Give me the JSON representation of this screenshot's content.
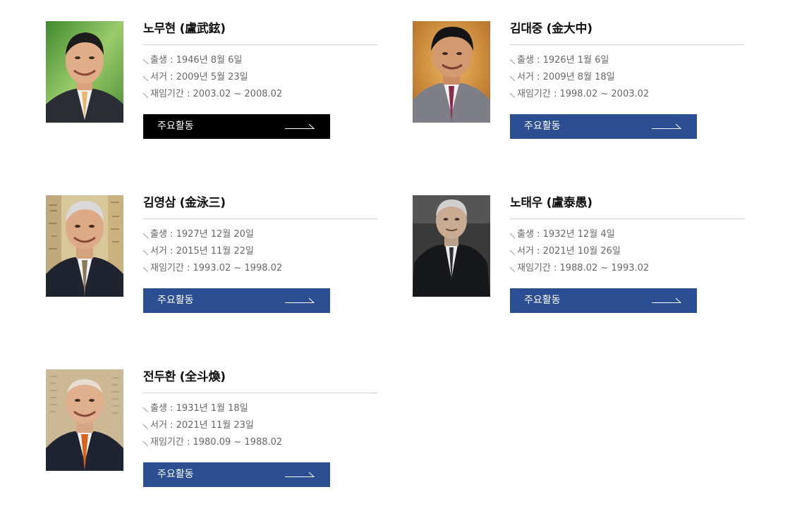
{
  "presidents": [
    {
      "name": "노무현 (盧武鉉)",
      "facts": [
        "출생 : 1946년 8월 6일",
        "서거 : 2009년 5월 23일",
        "재임기간 : 2003.02 ~ 2008.02"
      ],
      "button_label": "주요활동"
    },
    {
      "name": "김대중 (金大中)",
      "facts": [
        "출생 : 1926년 1월 6일",
        "서거 : 2009년 8월 18일",
        "재임기간 : 1998.02 ~ 2003.02"
      ],
      "button_label": "주요활동"
    },
    {
      "name": "김영삼 (金泳三)",
      "facts": [
        "출생 : 1927년 12월 20일",
        "서거 : 2015년 11월 22일",
        "재임기간 : 1993.02 ~ 1998.02"
      ],
      "button_label": "주요활동"
    },
    {
      "name": "노태우 (盧泰愚)",
      "facts": [
        "출생 : 1932년 12월 4일",
        "서거 : 2021년 10월 26일",
        "재임기간 : 1988.02 ~ 1993.02"
      ],
      "button_label": "주요활동"
    },
    {
      "name": "전두환 (全斗煥)",
      "facts": [
        "출생 : 1931년 1월 18일",
        "서거 : 2021년 11월 23일",
        "재임기간 : 1980.09 ~ 1988.02"
      ],
      "button_label": "주요활동"
    }
  ],
  "colors": {
    "button_default": "#2c4f94",
    "button_active": "#000000",
    "divider": "#cfcfcf",
    "fact_text": "#666666"
  },
  "icons": {
    "fact_marker": "diagonal-tick-icon",
    "button_arrow": "long-arrow-right-icon"
  }
}
